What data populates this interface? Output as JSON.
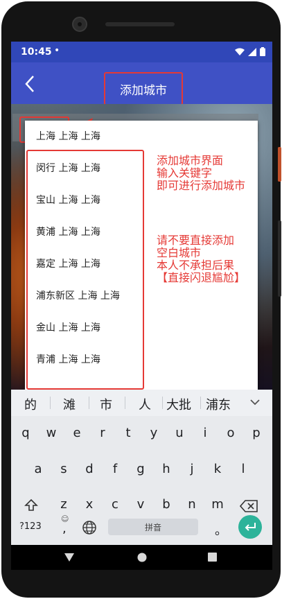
{
  "status_bar": {
    "time": "10:45",
    "dot": "•"
  },
  "app_bar": {
    "title": "添加城市"
  },
  "search": {
    "value": "上海"
  },
  "suggestions_list": [
    "上海 上海 上海",
    "闵行 上海 上海",
    "宝山 上海 上海",
    "黄浦 上海 上海",
    "嘉定 上海 上海",
    "浦东新区 上海 上海",
    "金山 上海 上海",
    "青浦 上海 上海"
  ],
  "annotations": {
    "note1": [
      "添加城市界面",
      "输入关键字",
      "即可进行添加城市"
    ],
    "note2": [
      "请不要直接添加",
      "空白城市",
      "本人不承担后果",
      "【直接闪退尴尬】"
    ]
  },
  "keyboard": {
    "candidates": [
      "的",
      "滩",
      "市",
      "人",
      "大批",
      "浦东"
    ],
    "row1": [
      "q",
      "w",
      "e",
      "r",
      "t",
      "y",
      "u",
      "i",
      "o",
      "p"
    ],
    "row2": [
      "a",
      "s",
      "d",
      "f",
      "g",
      "h",
      "j",
      "k",
      "l"
    ],
    "row3": [
      "z",
      "x",
      "c",
      "v",
      "b",
      "n",
      "m"
    ],
    "symbols_key": "?123",
    "comma_key": ",",
    "emoji_hint": "☺",
    "space_label": "拼音",
    "period_key": "。"
  },
  "colors": {
    "status_bar": "#3047b8",
    "app_bar": "#3f51c5",
    "annotation_red": "#e53935",
    "enter_key": "#2db39a"
  },
  "icons": [
    "wifi-icon",
    "signal-icon",
    "battery-icon",
    "back-arrow-icon",
    "red-arrow-icon",
    "chevron-down-icon",
    "shift-icon",
    "backspace-icon",
    "globe-icon",
    "enter-icon",
    "nav-back-icon",
    "nav-home-icon",
    "nav-recents-icon"
  ]
}
